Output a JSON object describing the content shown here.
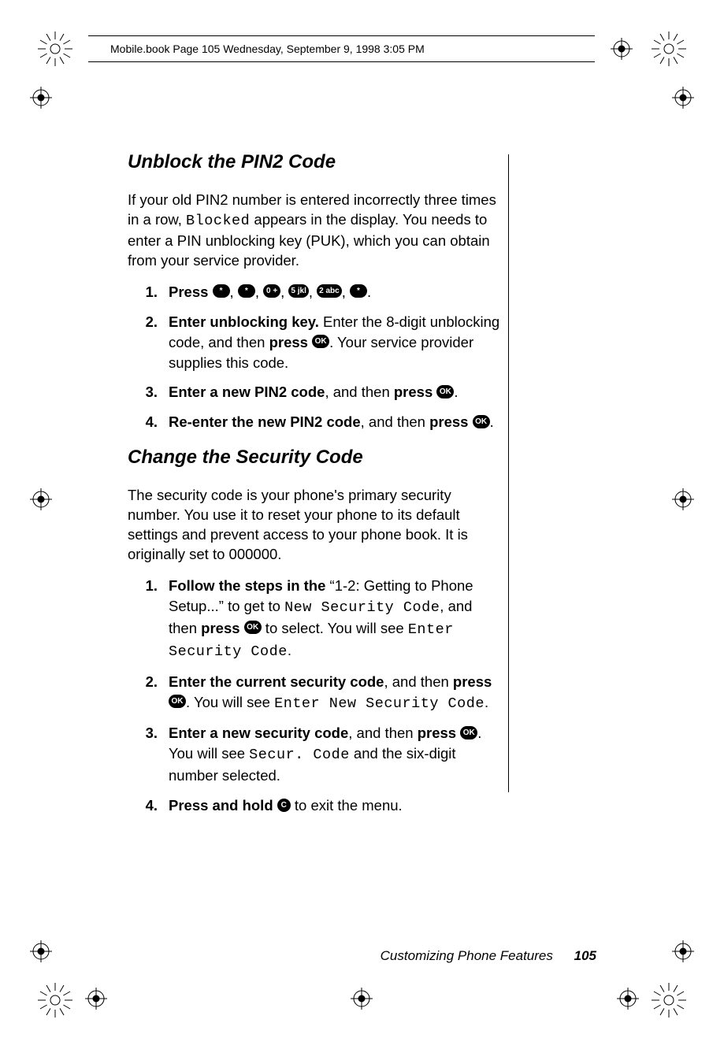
{
  "header": {
    "running_head": "Mobile.book  Page 105  Wednesday, September 9, 1998  3:05 PM"
  },
  "section1": {
    "title": "Unblock the PIN2 Code",
    "intro_a": "If your old PIN2 number is entered incorrectly three times in a row, ",
    "intro_blocked": "Blocked",
    "intro_b": " appears in the display. You needs to enter a PIN unblocking key (PUK), which you can obtain from your service provider.",
    "steps": {
      "s1": {
        "num": "1.",
        "lead": "Press ",
        "keys": [
          "*",
          "*",
          "0 +",
          "5 jkl",
          "2 abc",
          "*"
        ],
        "tail": "."
      },
      "s2": {
        "num": "2.",
        "lead_bold": "Enter unblocking key.",
        "mid_a": " Enter the 8-digit unblocking code, and then ",
        "press": "press ",
        "ok": "OK",
        "mid_b": ". Your service provider supplies this code."
      },
      "s3": {
        "num": "3.",
        "lead_bold": "Enter a new PIN2 code",
        "mid_a": ", and then ",
        "press": "press ",
        "ok": "OK",
        "tail": "."
      },
      "s4": {
        "num": "4.",
        "lead_bold": "Re-enter the new PIN2 code",
        "mid_a": ", and then ",
        "press": "press ",
        "ok": "OK",
        "tail": "."
      }
    }
  },
  "section2": {
    "title": "Change the Security Code",
    "intro": "The security code is your phone's primary security number. You use it to reset your phone to its default settings and prevent access to your phone book. It is originally set to 000000.",
    "steps": {
      "s1": {
        "num": "1.",
        "lead_bold": "Follow the steps in the",
        "a": " “1-2: Getting to Phone Setup...” to get to ",
        "lcd1": "New Security Code",
        "b": ", and then ",
        "press": "press ",
        "ok": "OK",
        "c": "  to select. You will see ",
        "lcd2": "Enter Security Code",
        "tail": "."
      },
      "s2": {
        "num": "2.",
        "lead_bold": "Enter the current security code",
        "a": ", and then ",
        "press": "press ",
        "ok": "OK",
        "b": ". You will see ",
        "lcd1": "Enter New Security Code",
        "tail": "."
      },
      "s3": {
        "num": "3.",
        "lead_bold": "Enter a new security code",
        "a": ", and then ",
        "press": "press ",
        "ok": "OK",
        "b": ". You will see ",
        "lcd1": "Secur. Code",
        "c": " and the six-digit number selected."
      },
      "s4": {
        "num": "4.",
        "lead_bold": "Press and hold ",
        "ckey": "C",
        "tail": " to exit the menu."
      }
    }
  },
  "footer": {
    "section_name": "Customizing Phone Features",
    "page": "105"
  },
  "icons": {
    "star": "✱",
    "ok": "OK",
    "c": "C"
  }
}
